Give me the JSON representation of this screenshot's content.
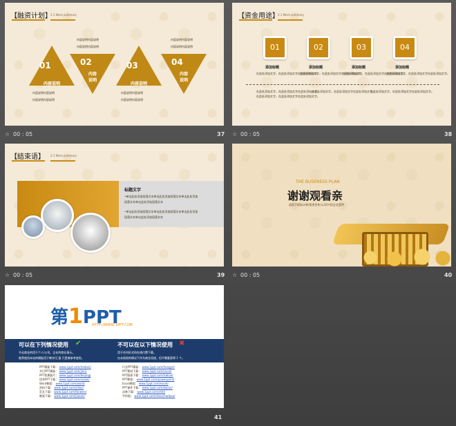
{
  "slides": [
    {
      "number": "37",
      "time": "00 : 05",
      "title": "【融资计划】",
      "subtitle": "2.1 Work summary",
      "items": [
        {
          "num": "01",
          "label": "内容说明"
        },
        {
          "num": "02",
          "label": "内容\n说明"
        },
        {
          "num": "03",
          "label": "内容说明"
        },
        {
          "num": "04",
          "label": "内容\n说明"
        }
      ],
      "note": "内容说明内容说明"
    },
    {
      "number": "38",
      "time": "00 : 05",
      "title": "【资金用途】",
      "subtitle": "2.1 Work summary",
      "boxes": [
        {
          "num": "01",
          "label": "添加标题"
        },
        {
          "num": "02",
          "label": "添加标题"
        },
        {
          "num": "03",
          "label": "添加标题"
        },
        {
          "num": "04",
          "label": "添加标题"
        }
      ],
      "body_text": "在此处添加文字，在此处添加文字在此处添加文字。"
    },
    {
      "number": "39",
      "time": "00 : 05",
      "title": "【结束语】",
      "subtitle": "2.1 Work summary",
      "heading": "标题文字",
      "lines": [
        "•单击此处添加段落文本单击此处添加段落文本单击此处添加",
        "段落文本单击此处添加段落文本",
        "•单击此处添加段落文本单击此处添加段落文本单击此处添加",
        "段落文本单击此处添加段落文本"
      ]
    },
    {
      "number": "40",
      "time": "00 : 05",
      "kicker": "THE BUSENESS PLAN",
      "headline": "谢谢观看亲",
      "sub": "适用于招标计划/投资合作/公司介绍/企业宣传"
    },
    {
      "number": "41",
      "logo_prefix": "第",
      "logo_num": "1",
      "logo_ppt": "PPT",
      "logo_url": "HTTP://WWW.1PPT.COM",
      "can_title": "可以在下列情况使用",
      "cannot_title": "不可以在以下情况使用",
      "can_items": [
        "不论商业的用于个人/公司、企业的商业演示。",
        "推荐使用本站的模板用于教学/汇报 只是做参考使用。"
      ],
      "cannot_items": [
        "用于任何形式的在线付费下载。",
        "在未授权的情况下作为商业用途，但不需要获得 1 个。"
      ],
      "left_links": [
        {
          "k": "PPT模板下载：",
          "v": "www.1ppt.com/moban/"
        },
        {
          "k": "节日PPT模板：",
          "v": "www.1ppt.com/jieri/"
        },
        {
          "k": "PPT背景图片：",
          "v": "www.1ppt.com/beijing/"
        },
        {
          "k": "优秀PPT下载：",
          "v": "www.1ppt.com/xiazai/"
        },
        {
          "k": "Word教程：",
          "v": "www.1ppt.com/word/"
        },
        {
          "k": "资料下载：",
          "v": "www.1ppt.com/ziliao/"
        },
        {
          "k": "范文下载：",
          "v": "www.1ppt.com/fanwen/"
        },
        {
          "k": "教案下载：",
          "v": "www.1ppt.com/jiaoan/"
        }
      ],
      "right_links": [
        {
          "k": "行业PPT模板：",
          "v": "www.1ppt.com/hangye/"
        },
        {
          "k": "PPT素材下载：",
          "v": "www.1ppt.com/sucai/"
        },
        {
          "k": "PPT图表下载：",
          "v": "www.1ppt.com/tubiao/"
        },
        {
          "k": "PPT教程：",
          "v": "www.1ppt.com/powerpoint/"
        },
        {
          "k": "Excel教程：",
          "v": "www.1ppt.com/excel/"
        },
        {
          "k": "PPT课件下载：",
          "v": "www.1ppt.com/kejian/"
        },
        {
          "k": "试卷下载：",
          "v": "www.1ppt.com/shiti/"
        },
        {
          "k": "手抄报：",
          "v": "www.1ppt.com/shouchaobao/"
        }
      ]
    }
  ],
  "colors": {
    "gold": "#c08916",
    "navy": "#1d3c6b",
    "blue": "#1f5fa8",
    "orange": "#f08a00"
  }
}
